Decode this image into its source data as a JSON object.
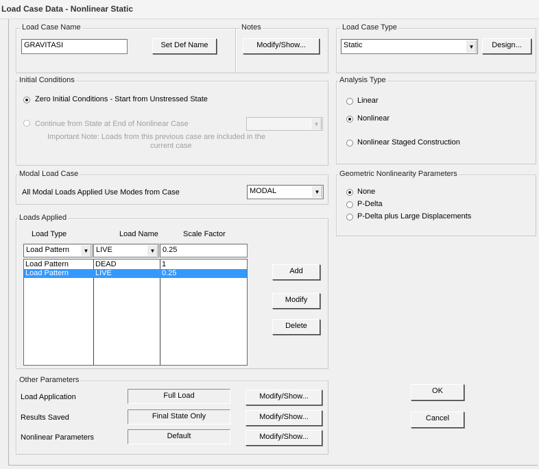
{
  "window": {
    "title": "Load Case Data - Nonlinear Static"
  },
  "load_case_name": {
    "legend": "Load Case Name",
    "value": "GRAVITASI",
    "set_def_button": "Set Def Name"
  },
  "notes": {
    "legend": "Notes",
    "button": "Modify/Show..."
  },
  "load_case_type": {
    "legend": "Load Case Type",
    "value": "Static",
    "design_button": "Design..."
  },
  "initial_conditions": {
    "legend": "Initial Conditions",
    "zero_option": "Zero Initial Conditions - Start from Unstressed State",
    "continue_option": "Continue from State at End of Nonlinear Case",
    "important_note": "Important Note:  Loads from this previous case are included in the",
    "important_note_2": "current case"
  },
  "analysis_type": {
    "legend": "Analysis Type",
    "options": [
      "Linear",
      "Nonlinear",
      "Nonlinear Staged Construction"
    ],
    "selected": "Nonlinear"
  },
  "modal_load_case": {
    "legend": "Modal Load Case",
    "label": "All Modal Loads Applied Use Modes from Case",
    "value": "MODAL"
  },
  "geometric_nonlinearity": {
    "legend": "Geometric Nonlinearity Parameters",
    "options": [
      "None",
      "P-Delta",
      "P-Delta plus Large Displacements"
    ],
    "selected": "None"
  },
  "loads_applied": {
    "legend": "Loads Applied",
    "headers": {
      "load_type": "Load Type",
      "load_name": "Load Name",
      "scale_factor": "Scale Factor"
    },
    "edit_row": {
      "load_type": "Load Pattern",
      "load_name": "LIVE",
      "scale_factor": "0.25"
    },
    "rows": [
      {
        "load_type": "Load Pattern",
        "load_name": "DEAD",
        "scale_factor": "1",
        "selected": false
      },
      {
        "load_type": "Load Pattern",
        "load_name": "LIVE",
        "scale_factor": "0.25",
        "selected": true
      }
    ],
    "add_button": "Add",
    "modify_button": "Modify",
    "delete_button": "Delete"
  },
  "other_parameters": {
    "legend": "Other Parameters",
    "load_application": {
      "label": "Load Application",
      "value": "Full Load",
      "button": "Modify/Show..."
    },
    "results_saved": {
      "label": "Results Saved",
      "value": "Final State Only",
      "button": "Modify/Show..."
    },
    "nonlinear_parameters": {
      "label": "Nonlinear Parameters",
      "value": "Default",
      "button": "Modify/Show..."
    }
  },
  "dialog_buttons": {
    "ok": "OK",
    "cancel": "Cancel"
  },
  "icons": {
    "dropdown": "chevron-down-icon",
    "radio": "radio-icon"
  }
}
